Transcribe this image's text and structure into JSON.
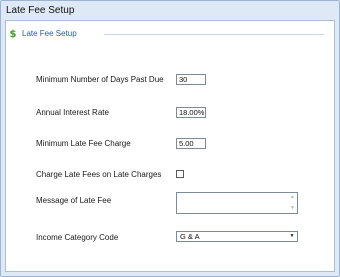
{
  "window": {
    "title": "Late Fee Setup"
  },
  "section": {
    "label": "Late Fee Setup",
    "icon": "dollar-icon"
  },
  "fields": {
    "min_days": {
      "label": "Minimum Number of Days Past Due",
      "value": "30"
    },
    "interest": {
      "label": "Annual Interest Rate",
      "value": "18.00%"
    },
    "min_charge": {
      "label": "Minimum Late Fee Charge",
      "value": "5.00"
    },
    "charge_on_late": {
      "label": "Charge Late Fees on Late Charges",
      "checked": false
    },
    "message": {
      "label": "Message of Late Fee",
      "value": ""
    },
    "income_category": {
      "label": "Income Category Code",
      "value": "G & A"
    }
  },
  "colors": {
    "section_accent": "#1d5fb3",
    "icon": "#3f9a27",
    "window_bg": "#dfe9f6"
  }
}
